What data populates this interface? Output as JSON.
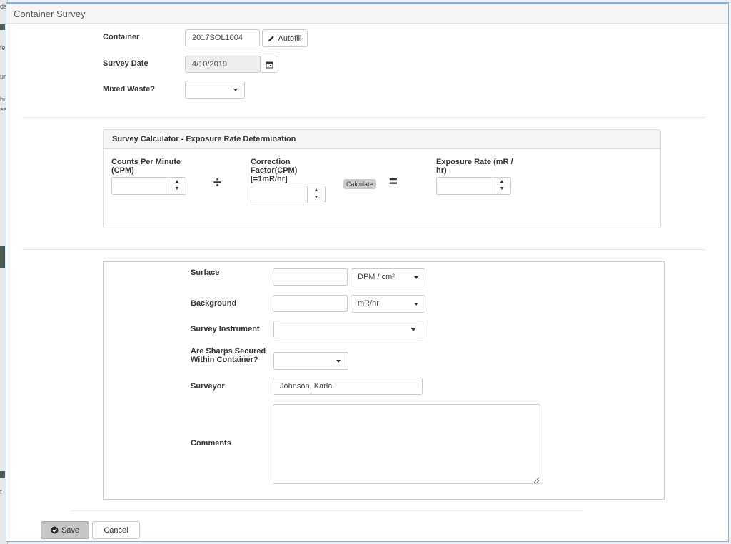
{
  "window": {
    "title": "Container Survey"
  },
  "form": {
    "container": {
      "label": "Container",
      "value": "2017SOL1004",
      "autofill_label": "Autofill"
    },
    "survey_date": {
      "label": "Survey Date",
      "value": "4/10/2019"
    },
    "mixed_waste": {
      "label": "Mixed Waste?",
      "value": ""
    }
  },
  "calculator": {
    "title": "Survey Calculator - Exposure Rate Determination",
    "cpm_label": "Counts Per Minute (CPM)",
    "divide_symbol": "÷",
    "correction_label": "Correction Factor(CPM) [=1mR/hr]",
    "calculate_label": "Calculate",
    "equals_symbol": "=",
    "exposure_label": "Exposure Rate (mR / hr)"
  },
  "details": {
    "surface": {
      "label": "Surface",
      "value": "",
      "unit": "DPM / cm²"
    },
    "background": {
      "label": "Background",
      "value": "",
      "unit": "mR/hr"
    },
    "instrument": {
      "label": "Survey Instrument",
      "value": ""
    },
    "sharps": {
      "label": "Are Sharps Secured Within Container?",
      "value": ""
    },
    "surveyor": {
      "label": "Surveyor",
      "value": "Johnson, Karla"
    },
    "comments": {
      "label": "Comments",
      "value": ""
    }
  },
  "footer": {
    "save_label": "Save",
    "cancel_label": "Cancel"
  },
  "background_fragments": [
    "ds",
    "fe",
    "ur",
    "hi",
    "se",
    "t"
  ]
}
